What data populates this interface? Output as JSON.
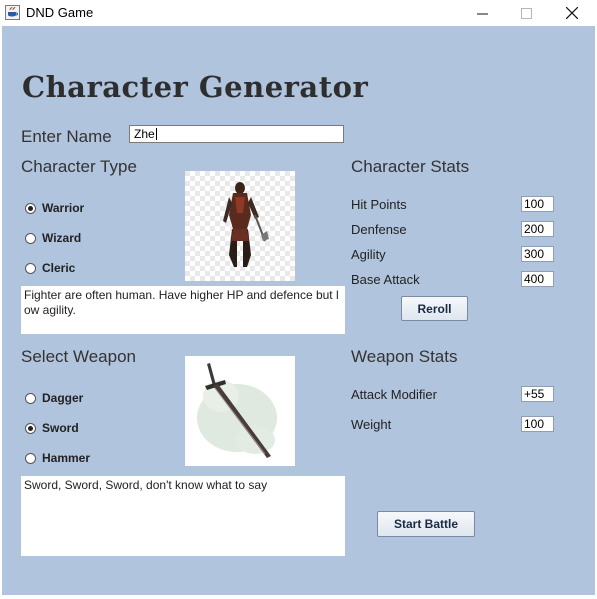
{
  "window": {
    "title": "DND Game",
    "controls": {
      "minimize": "—",
      "maximize": "☐",
      "close": "✕"
    }
  },
  "header": {
    "title": "Character Generator"
  },
  "name": {
    "label": "Enter Name",
    "value": "Zhe"
  },
  "character_type": {
    "label": "Character Type",
    "options": [
      {
        "label": "Warrior",
        "checked": true
      },
      {
        "label": "Wizard",
        "checked": false
      },
      {
        "label": "Cleric",
        "checked": false
      }
    ],
    "description": "Fighter are often human. Have higher HP and defence but low agility."
  },
  "character_stats": {
    "label": "Character Stats",
    "hit_points": {
      "label": "Hit Points",
      "value": "100"
    },
    "defense": {
      "label": "Denfense",
      "value": "200"
    },
    "agility": {
      "label": "Agility",
      "value": "300"
    },
    "base_attack": {
      "label": "Base Attack",
      "value": "400"
    },
    "reroll_label": "Reroll"
  },
  "weapon": {
    "label": "Select Weapon",
    "options": [
      {
        "label": "Dagger",
        "checked": false
      },
      {
        "label": "Sword",
        "checked": true
      },
      {
        "label": "Hammer",
        "checked": false
      }
    ],
    "description": "Sword, Sword, Sword, don't know what to say"
  },
  "weapon_stats": {
    "label": "Weapon Stats",
    "attack_modifier": {
      "label": "Attack Modifier",
      "value": "+55"
    },
    "weight": {
      "label": "Weight",
      "value": "100"
    }
  },
  "start_battle_label": "Start Battle",
  "colors": {
    "background": "#b0c4de",
    "button_text": "#1a2a44"
  }
}
